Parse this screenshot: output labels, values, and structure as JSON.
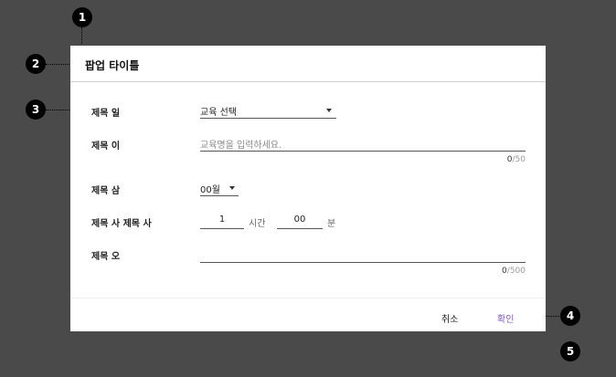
{
  "annotations": [
    "1",
    "2",
    "3",
    "4",
    "5"
  ],
  "popup": {
    "title": "팝업 타이틀",
    "fields": {
      "field1": {
        "label": "제목 일",
        "value": "교육 선택"
      },
      "field2": {
        "label": "제목 이",
        "placeholder": "교육명을 입력하세요.",
        "count": "0",
        "max": "/50"
      },
      "field3": {
        "label": "제목 삼",
        "value": "00월"
      },
      "field4": {
        "label": "제목 사 제목 사",
        "hours": "1",
        "hours_unit": "시간",
        "minutes": "00",
        "minutes_unit": "분"
      },
      "field5": {
        "label": "제목 오",
        "count": "0",
        "max": "/500"
      }
    },
    "buttons": {
      "cancel": "취소",
      "confirm": "확인"
    }
  }
}
